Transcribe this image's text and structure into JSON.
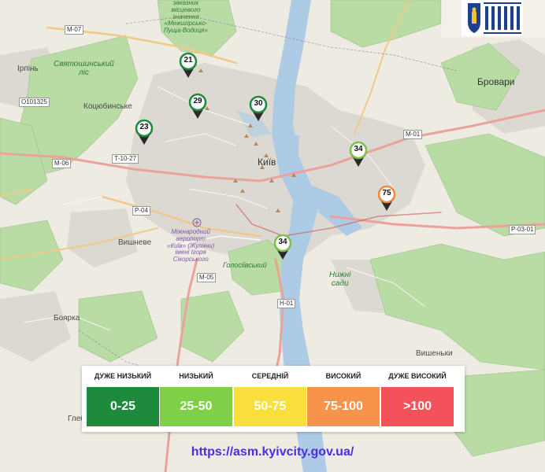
{
  "map": {
    "places": {
      "irpin": "Ірпінь",
      "kotsiubynske": "Коцюбинське",
      "sviatoshynskyi_lis": "Святошинський\nліс",
      "kyiv": "Київ",
      "brovary": "Бровари",
      "vyshneve": "Вишневе",
      "boiarka": "Боярка",
      "nyzhni_sady": "Нижні\nсади",
      "holosiivskyi": "Голосіївський",
      "vyshenky": "Вишеньки",
      "mezhyhirskyi": "заказник\nмісцевого\nзначення\n«Межигірсько-\nПуща-Водиця»",
      "airport": "Міжнародний\nаеропорт\n«Київ» (Жуляни)\nімені Ігоря\nСікорського",
      "hleb": "Глеб"
    },
    "roads": {
      "m07": "М-07",
      "o101325": "О101325",
      "m06": "М-06",
      "t1027": "Т-10-27",
      "m01": "М-01",
      "p04": "Р-04",
      "m05": "М-05",
      "h01": "Н-01",
      "p0301": "Р-03-01"
    }
  },
  "markers": [
    {
      "value": 21,
      "color": "#1f8a3b"
    },
    {
      "value": 29,
      "color": "#1f8a3b"
    },
    {
      "value": 30,
      "color": "#1f8a3b"
    },
    {
      "value": 23,
      "color": "#1f8a3b"
    },
    {
      "value": 34,
      "color": "#7cc24a"
    },
    {
      "value": 75,
      "color": "#f0883e"
    },
    {
      "value": 34,
      "color": "#7cc24a"
    }
  ],
  "legend": [
    {
      "label": "ДУЖЕ НИЗЬКИЙ",
      "range": "0-25",
      "color": "#1e8a3c"
    },
    {
      "label": "НИЗЬКИЙ",
      "range": "25-50",
      "color": "#7fcf47"
    },
    {
      "label": "СЕРЕДНІЙ",
      "range": "50-75",
      "color": "#f9df3b"
    },
    {
      "label": "ВИСОКИЙ",
      "range": "75-100",
      "color": "#f7934a"
    },
    {
      "label": "ДУЖЕ ВИСОКИЙ",
      "range": ">100",
      "color": "#f4525a"
    }
  ],
  "logo_text": "КИЇВСЬКА МІСЬКА ВІЙСЬКОВА АДМІНІСТРАЦІЯ",
  "url": "https://asm.kyivcity.gov.ua/"
}
